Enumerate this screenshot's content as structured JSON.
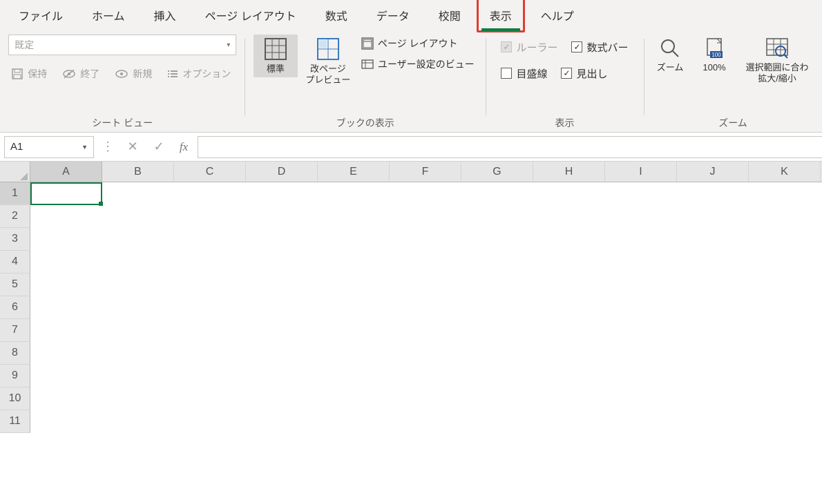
{
  "tabs": {
    "file": "ファイル",
    "home": "ホーム",
    "insert": "挿入",
    "page_layout": "ページ レイアウト",
    "formulas": "数式",
    "data": "データ",
    "review": "校閲",
    "view": "表示",
    "help": "ヘルプ"
  },
  "ribbon": {
    "sheet_view": {
      "label": "シート ビュー",
      "combo": "既定",
      "keep": "保持",
      "exit": "終了",
      "new": "新規",
      "options": "オプション"
    },
    "workbook_views": {
      "label": "ブックの表示",
      "normal": "標準",
      "page_break": "改ページ\nプレビュー",
      "page_layout": "ページ レイアウト",
      "custom_views": "ユーザー設定のビュー"
    },
    "show": {
      "label": "表示",
      "ruler": "ルーラー",
      "formula_bar": "数式バー",
      "gridlines": "目盛線",
      "headings": "見出し"
    },
    "zoom": {
      "label": "ズーム",
      "zoom": "ズーム",
      "hundred": "100%",
      "to_selection": "選択範囲に合わ\n拡大/縮小"
    }
  },
  "formula_bar": {
    "name_box": "A1",
    "fx": "fx",
    "value": ""
  },
  "grid": {
    "columns": [
      "A",
      "B",
      "C",
      "D",
      "E",
      "F",
      "G",
      "H",
      "I",
      "J",
      "K"
    ],
    "rows": [
      1,
      2,
      3,
      4,
      5,
      6,
      7,
      8,
      9,
      10,
      11
    ],
    "selected": "A1"
  }
}
